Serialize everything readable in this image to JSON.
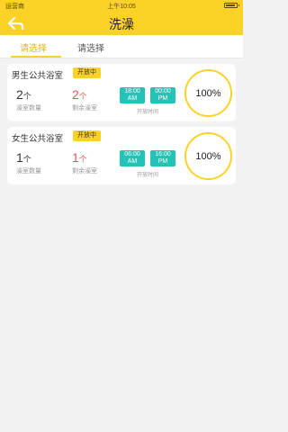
{
  "status_bar": {
    "carrier": "运营商",
    "time": "上午10:05"
  },
  "nav": {
    "title": "洗澡",
    "back_icon": "back-arrow-icon"
  },
  "tabs": [
    {
      "label": "请选择",
      "active": true
    },
    {
      "label": "请选择",
      "active": false
    }
  ],
  "cards": [
    {
      "title": "男生公共浴室",
      "badge": "开放中",
      "total": {
        "num": "2",
        "unit": "个",
        "label": "澡室数量"
      },
      "remain": {
        "num": "2",
        "unit": "个",
        "label": "剩余澡室"
      },
      "start": {
        "time": "18:00",
        "ampm": "AM"
      },
      "end": {
        "time": "00:00",
        "ampm": "PM"
      },
      "open_label": "开放时间",
      "percent": "100%"
    },
    {
      "title": "女生公共浴室",
      "badge": "开放中",
      "total": {
        "num": "1",
        "unit": "个",
        "label": "澡室数量"
      },
      "remain": {
        "num": "1",
        "unit": "个",
        "label": "剩余澡室"
      },
      "start": {
        "time": "06:00",
        "ampm": "AM"
      },
      "end": {
        "time": "16:00",
        "ampm": "PM"
      },
      "open_label": "开放时间",
      "percent": "100%"
    }
  ],
  "colors": {
    "accent": "#fdd227",
    "teal": "#23c3b5",
    "remain_red": "#e25858"
  }
}
